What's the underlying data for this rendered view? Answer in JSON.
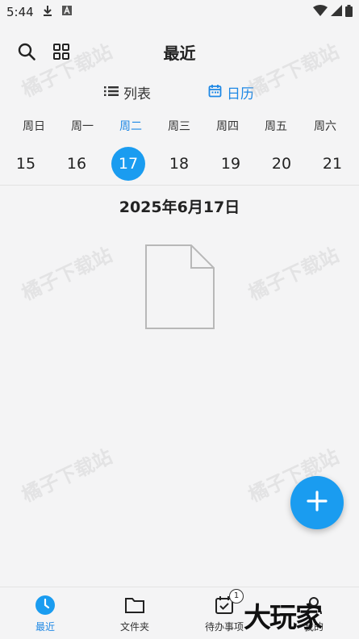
{
  "status_bar": {
    "time": "5:44"
  },
  "header": {
    "title": "最近"
  },
  "view_toggle": {
    "list_label": "列表",
    "calendar_label": "日历"
  },
  "week": {
    "days": [
      "周日",
      "周一",
      "周二",
      "周三",
      "周四",
      "周五",
      "周六"
    ],
    "dates": [
      "15",
      "16",
      "17",
      "18",
      "19",
      "20",
      "21"
    ],
    "selected_index": 2
  },
  "date_heading": "2025年6月17日",
  "watermark_text": "橘子下载站",
  "bottom_nav": {
    "items": [
      {
        "label": "最近",
        "icon": "clock-icon"
      },
      {
        "label": "文件夹",
        "icon": "folder-icon"
      },
      {
        "label": "待办事项",
        "icon": "calendar-check-icon",
        "badge": "1"
      },
      {
        "label": "我的",
        "icon": "person-icon"
      }
    ]
  },
  "brand_logo": "大玩家",
  "colors": {
    "accent": "#1a9cf0",
    "background": "#f4f4f5"
  }
}
